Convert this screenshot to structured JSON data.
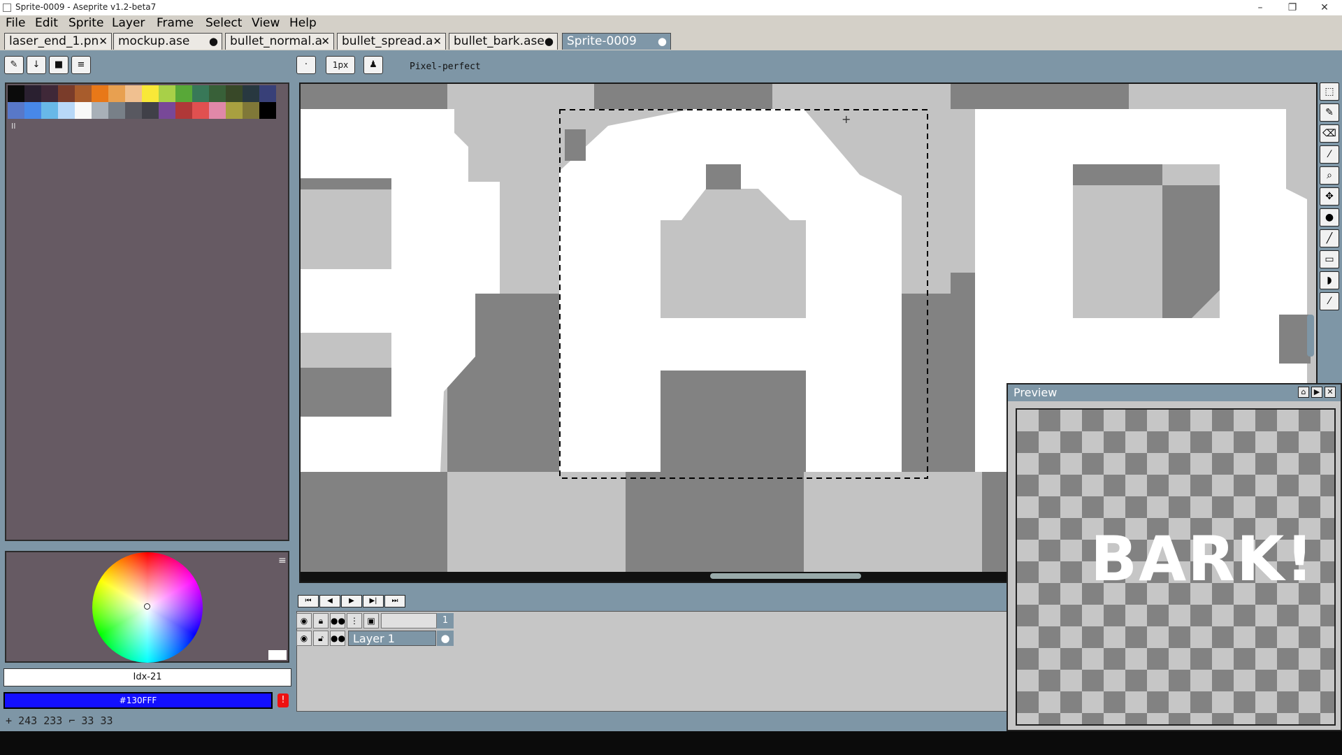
{
  "window": {
    "title": "Sprite-0009 - Aseprite v1.2-beta7",
    "minimize_glyph": "–",
    "maximize_glyph": "❐",
    "close_glyph": "✕"
  },
  "menu": [
    "File",
    "Edit",
    "Sprite",
    "Layer",
    "Frame",
    "Select",
    "View",
    "Help"
  ],
  "tabs": [
    {
      "label": "laser_end_1.pn",
      "marker": "✕"
    },
    {
      "label": "mockup.ase",
      "marker": "●"
    },
    {
      "label": "bullet_normal.a",
      "marker": "✕"
    },
    {
      "label": "bullet_spread.a",
      "marker": "✕"
    },
    {
      "label": "bullet_bark.ase",
      "marker": "●"
    },
    {
      "label": "Sprite-0009",
      "marker": "●",
      "active": true
    }
  ],
  "toolbar": {
    "brush_size": "1px",
    "pixel_perfect_label": "Pixel-perfect"
  },
  "palette": {
    "colors": [
      "#0b0b0b",
      "#2a2030",
      "#3f2838",
      "#7a3c2a",
      "#a85c2c",
      "#e87818",
      "#e8a050",
      "#f0c090",
      "#f8e838",
      "#a8d048",
      "#58a838",
      "#387858",
      "#386038",
      "#384828",
      "#283840",
      "#384078",
      "#5878c8",
      "#4888e8",
      "#68b8e8",
      "#b8d8f8",
      "#f8f8f8",
      "#a8b0b8",
      "#788088",
      "#585860",
      "#404048",
      "#784898",
      "#b03838",
      "#e05050",
      "#e088a8",
      "#a8a040",
      "#807838",
      "#000000"
    ],
    "footer_glyph": "II"
  },
  "color": {
    "foreground_label": "Idx-21",
    "background_hex_label": "#130FFF",
    "accent": "#130FFF",
    "warning_glyph": "!"
  },
  "status": {
    "pos_icon": "+",
    "x": "243",
    "y": "233",
    "size_icon": "⌐",
    "w": "33",
    "h": "33"
  },
  "timeline": {
    "frame_number": "1",
    "layer_name": "Layer 1"
  },
  "preview": {
    "title": "Preview",
    "art_text": "BARK!"
  }
}
